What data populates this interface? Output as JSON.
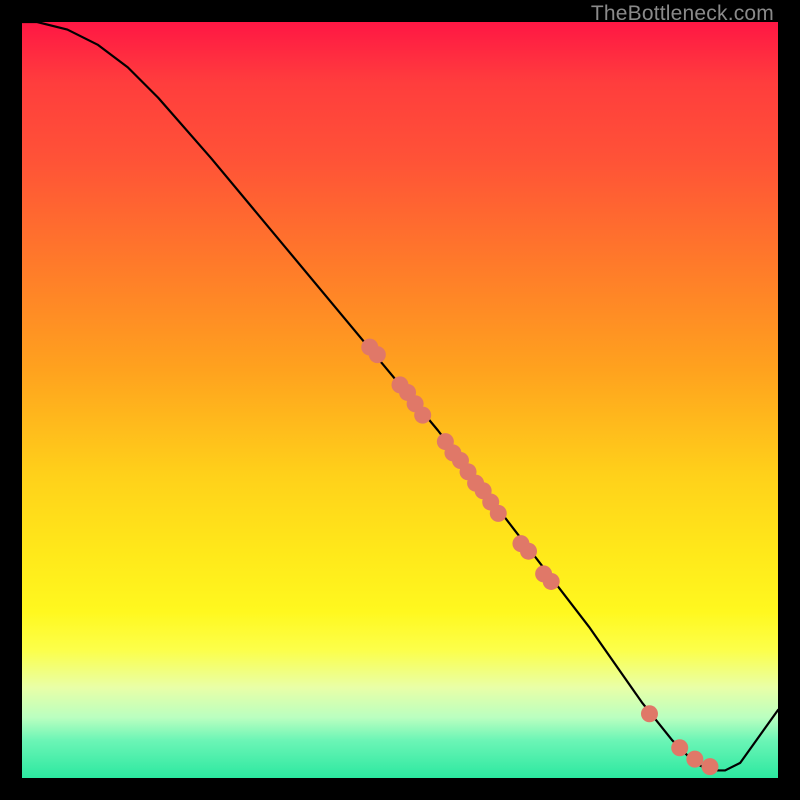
{
  "watermark": "TheBottleneck.com",
  "chart_data": {
    "type": "line",
    "title": "",
    "xlabel": "",
    "ylabel": "",
    "xlim": [
      0,
      100
    ],
    "ylim": [
      0,
      100
    ],
    "series": [
      {
        "name": "curve",
        "points": [
          {
            "x": 0,
            "y": 100
          },
          {
            "x": 2,
            "y": 100
          },
          {
            "x": 6,
            "y": 99
          },
          {
            "x": 10,
            "y": 97
          },
          {
            "x": 14,
            "y": 94
          },
          {
            "x": 18,
            "y": 90
          },
          {
            "x": 25,
            "y": 82
          },
          {
            "x": 35,
            "y": 70
          },
          {
            "x": 45,
            "y": 58
          },
          {
            "x": 55,
            "y": 46
          },
          {
            "x": 65,
            "y": 33
          },
          {
            "x": 75,
            "y": 20
          },
          {
            "x": 82,
            "y": 10
          },
          {
            "x": 86,
            "y": 5
          },
          {
            "x": 89,
            "y": 2
          },
          {
            "x": 91,
            "y": 1
          },
          {
            "x": 93,
            "y": 1
          },
          {
            "x": 95,
            "y": 2
          },
          {
            "x": 100,
            "y": 9
          }
        ]
      }
    ],
    "markers": [
      {
        "x": 46,
        "y": 57
      },
      {
        "x": 47,
        "y": 56
      },
      {
        "x": 50,
        "y": 52
      },
      {
        "x": 51,
        "y": 51
      },
      {
        "x": 52,
        "y": 49.5
      },
      {
        "x": 53,
        "y": 48
      },
      {
        "x": 56,
        "y": 44.5
      },
      {
        "x": 57,
        "y": 43
      },
      {
        "x": 58,
        "y": 42
      },
      {
        "x": 59,
        "y": 40.5
      },
      {
        "x": 60,
        "y": 39
      },
      {
        "x": 61,
        "y": 38
      },
      {
        "x": 62,
        "y": 36.5
      },
      {
        "x": 63,
        "y": 35
      },
      {
        "x": 66,
        "y": 31
      },
      {
        "x": 67,
        "y": 30
      },
      {
        "x": 69,
        "y": 27
      },
      {
        "x": 70,
        "y": 26
      },
      {
        "x": 83,
        "y": 8.5
      },
      {
        "x": 87,
        "y": 4
      },
      {
        "x": 89,
        "y": 2.5
      },
      {
        "x": 91,
        "y": 1.5
      }
    ],
    "gradient_stops": [
      {
        "pos": 0,
        "color": "#ff1744"
      },
      {
        "pos": 50,
        "color": "#ffd11a"
      },
      {
        "pos": 85,
        "color": "#fcff49"
      },
      {
        "pos": 100,
        "color": "#2ce8a0"
      }
    ]
  }
}
